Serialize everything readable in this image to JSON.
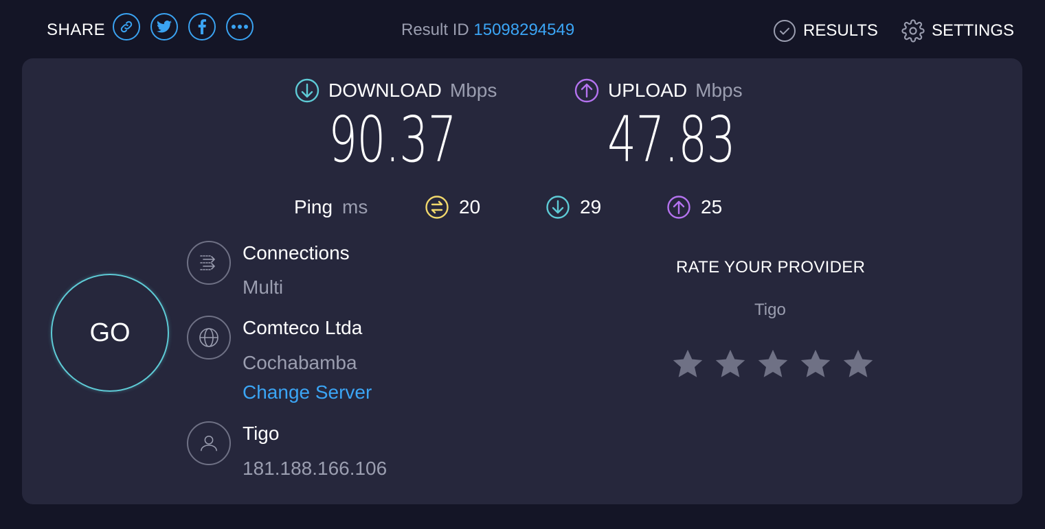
{
  "header": {
    "share_label": "SHARE",
    "share_buttons": [
      "link-icon",
      "twitter-icon",
      "facebook-icon",
      "more-icon"
    ],
    "result_id_label": "Result ID",
    "result_id_value": "15098294549",
    "results_label": "RESULTS",
    "settings_label": "SETTINGS"
  },
  "download": {
    "label": "DOWNLOAD",
    "unit": "Mbps",
    "value": "90.37",
    "color": "#5ecbd6"
  },
  "upload": {
    "label": "UPLOAD",
    "unit": "Mbps",
    "value": "47.83",
    "color": "#b573f0"
  },
  "ping": {
    "label": "Ping",
    "unit": "ms",
    "idle": "20",
    "download": "29",
    "upload": "25",
    "idle_color": "#f2d96c"
  },
  "go_label": "GO",
  "connections": {
    "title": "Connections",
    "value": "Multi"
  },
  "server": {
    "name": "Comteco Ltda",
    "location": "Cochabamba",
    "change_label": "Change Server"
  },
  "provider": {
    "name": "Tigo",
    "ip": "181.188.166.106"
  },
  "rating": {
    "title": "RATE YOUR PROVIDER",
    "provider": "Tigo",
    "stars_total": 5,
    "stars_selected": 0
  },
  "colors": {
    "accent": "#3ba5f5",
    "background": "#141526",
    "panel": "#26273c",
    "muted": "#9b9eb0"
  }
}
